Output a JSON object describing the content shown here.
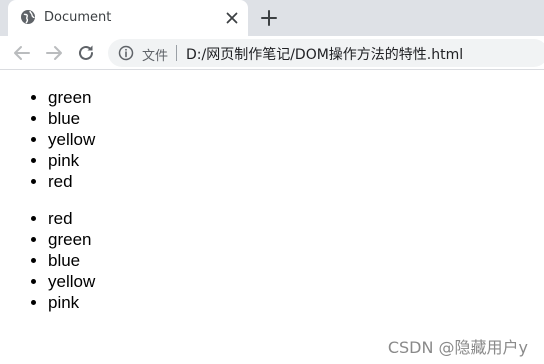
{
  "tab": {
    "title": "Document"
  },
  "address": {
    "file_label": "文件",
    "url": "D:/网页制作笔记/DOM操作方法的特性.html"
  },
  "icons": {
    "tab_favicon": "globe-icon",
    "tab_close": "close-icon",
    "new_tab": "plus-icon",
    "back": "arrow-left-icon",
    "forward": "arrow-right-icon",
    "reload": "reload-icon",
    "site_info": "info-icon"
  },
  "lists": [
    {
      "items": [
        "green",
        "blue",
        "yellow",
        "pink",
        "red"
      ]
    },
    {
      "items": [
        "red",
        "green",
        "blue",
        "yellow",
        "pink"
      ]
    }
  ],
  "watermark": "CSDN @隐藏用户y",
  "colors": {
    "tab_strip": "#dee1e6",
    "omnibox": "#f1f3f4",
    "page_bg": "#ffffff"
  }
}
